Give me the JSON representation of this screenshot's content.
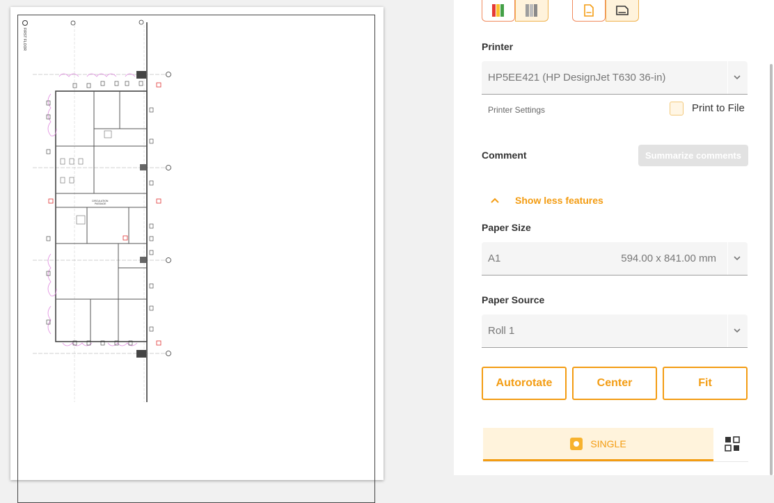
{
  "preview": {
    "stamp_text": "FIRST FLOOR",
    "room_labels": [
      "CIRCULATION",
      "PASSAGE"
    ]
  },
  "panel": {
    "color_mode_buttons": [
      {
        "icon": "color-mode-icon",
        "active": true
      },
      {
        "icon": "grayscale-mode-icon",
        "active": false
      }
    ],
    "orientation_buttons": [
      {
        "icon": "portrait-icon",
        "active": true
      },
      {
        "icon": "landscape-icon",
        "active": false
      }
    ],
    "printer": {
      "label": "Printer",
      "value": "HP5EE421 (HP DesignJet T630 36-in)",
      "settings_link": "Printer Settings",
      "print_to_file_label": "Print to File"
    },
    "comment": {
      "label": "Comment",
      "summarize_button": "Summarize comments"
    },
    "show_less": "Show less features",
    "paper_size": {
      "label": "Paper Size",
      "value": "A1",
      "dimensions": "594.00 x 841.00 mm"
    },
    "paper_source": {
      "label": "Paper Source",
      "value": "Roll 1"
    },
    "buttons": {
      "autorotate": "Autorotate",
      "center": "Center",
      "fit": "Fit"
    },
    "tabs": {
      "single": "SINGLE"
    },
    "colors": {
      "accent": "#f39c12",
      "accent_light": "#fff3dc"
    }
  }
}
